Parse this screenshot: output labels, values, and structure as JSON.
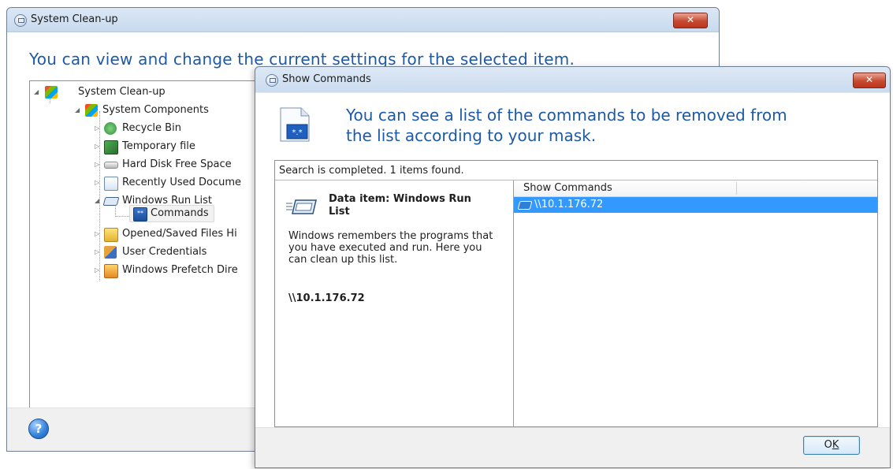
{
  "main_window": {
    "title": "System Clean-up",
    "heading": "You can view and change the current settings for the selected item.",
    "tree": [
      {
        "label": "System Clean-up",
        "icon": "windows-flag-icon"
      },
      {
        "label": "System Components",
        "icon": "windows-flag-icon"
      },
      {
        "label": "Recycle Bin",
        "icon": "recycle-bin-icon"
      },
      {
        "label": "Temporary file",
        "icon": "temporary-file-icon"
      },
      {
        "label": "Hard Disk Free Space",
        "icon": "hard-disk-icon"
      },
      {
        "label": "Recently Used Docume",
        "icon": "recent-documents-icon"
      },
      {
        "label": "Windows Run List",
        "icon": "run-list-icon"
      },
      {
        "label": "Commands",
        "icon": "commands-icon"
      },
      {
        "label": "Opened/Saved Files Hi",
        "icon": "folder-icon"
      },
      {
        "label": "User Credentials",
        "icon": "user-credentials-icon"
      },
      {
        "label": "Windows Prefetch Dire",
        "icon": "prefetch-folder-icon"
      }
    ],
    "help_icon": "help-icon"
  },
  "dialog": {
    "title": "Show Commands",
    "heading_line1": "You can see a list of the commands to be removed from",
    "heading_line2": "the list according to your mask.",
    "status": "Search is completed. 1 items found.",
    "info_title": "Data item: Windows Run List",
    "info_description": "Windows remembers the programs that you have executed and run. Here you can clean up this list.",
    "info_value": "\\\\10.1.176.72",
    "list": {
      "columns": [
        "Show Commands",
        ""
      ],
      "rows": [
        "\\\\10.1.176.72"
      ]
    },
    "ok_button_prefix": "O",
    "ok_button_access_key": "K"
  },
  "colors": {
    "heading_blue": "#1d5aa6",
    "selection_blue": "#3399ff",
    "close_red": "#c74a31"
  }
}
